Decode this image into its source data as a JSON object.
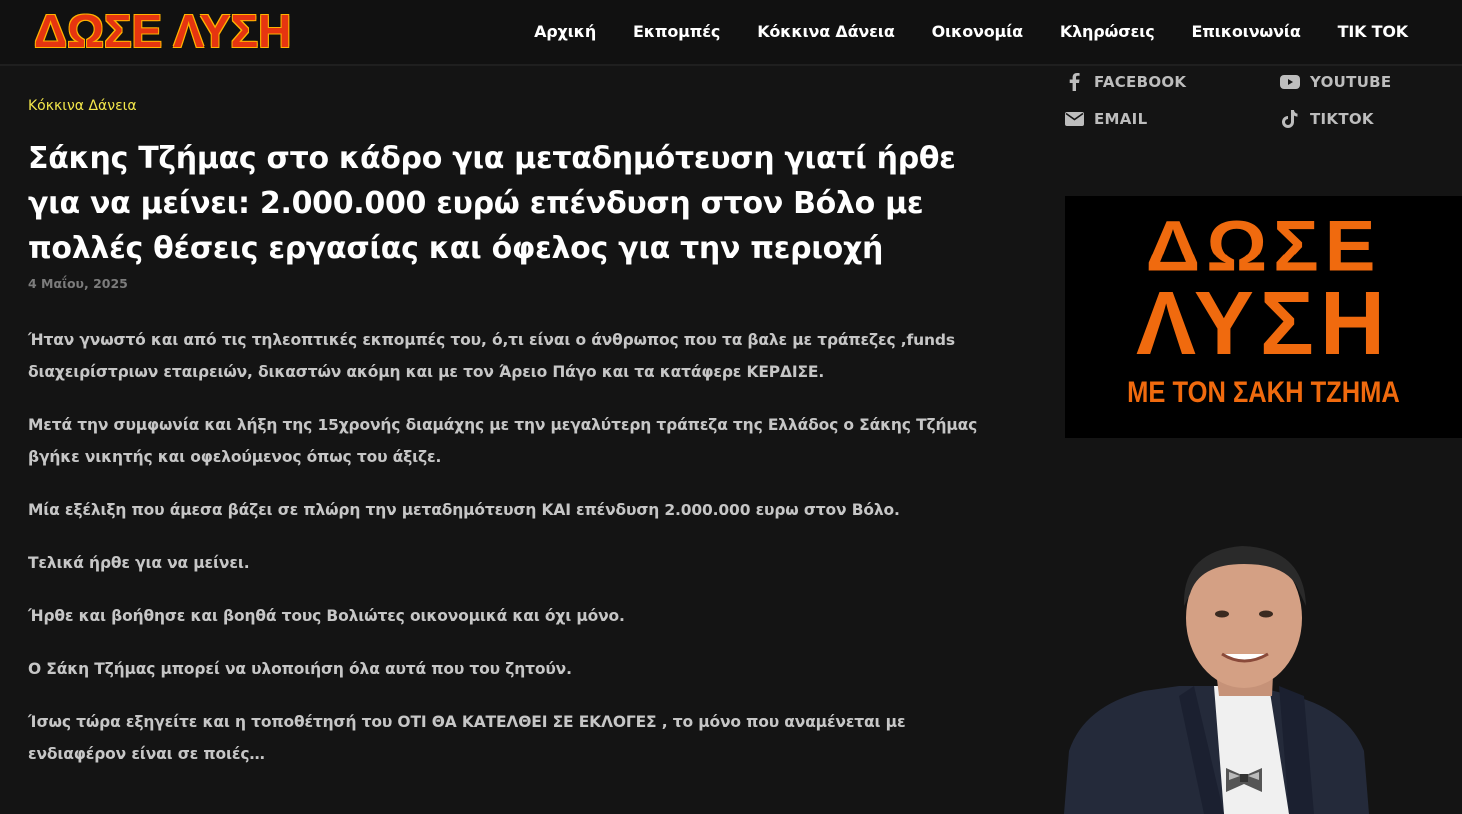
{
  "header": {
    "logo_text": "ΔΩΣΕ ΛΥΣΗ",
    "nav": [
      "Αρχική",
      "Εκπομπές",
      "Κόκκινα Δάνεια",
      "Οικονομία",
      "Κληρώσεις",
      "Επικοινωνία",
      "TIK TOK"
    ]
  },
  "article": {
    "category": "Κόκκινα Δάνεια",
    "title": "Σάκης Τζήμας στο κάδρο για μεταδημότευση γιατί ήρθε για να μείνει: 2.000.000 ευρώ επένδυση στον Βόλο με πολλές θέσεις εργασίας και όφελος για την περιοχή",
    "date": "4 Μαΐου, 2025",
    "paragraphs": [
      "Ήταν γνωστό και από τις τηλεοπτικές εκπομπές του, ό,τι είναι ο άνθρωπος που τα βαλε με τράπεζες ,funds διαχειρίστριων εταιρειών, δικαστών ακόμη και με τον Άρειο Πάγο και τα κατάφερε ΚΕΡΔΙΣΕ.",
      "Μετά την συμφωνία και λήξη της 15χρονής διαμάχης με την μεγαλύτερη τράπεζα της Ελλάδος ο Σάκης Τζήμας βγήκε νικητής και οφελούμενος όπως του άξιζε.",
      "Μία εξέλιξη που άμεσα βάζει σε πλώρη την μεταδημότευση ΚΑΙ επένδυση 2.000.000 ευρω στον Βόλο.",
      "Τελικά ήρθε για να μείνει.",
      "Ήρθε και βοήθησε και βοηθά τους Βολιώτες οικονομικά και όχι μόνο.",
      "Ο Σάκη Τζήμας μπορεί να υλοποιήση όλα αυτά που του ζητούν.",
      "Ίσως τώρα εξηγείτε και η τοποθέτησή του ΟΤΙ ΘΑ ΚΑΤΕΛΘΕΙ ΣΕ ΕΚΛΟΓΕΣ , το μόνο που αναμένεται με ενδιαφέρον είναι σε ποιές…"
    ]
  },
  "sidebar": {
    "social": {
      "facebook": "FACEBOOK",
      "youtube": "YOUTUBE",
      "email": "EMAIL",
      "tiktok": "TIKTOK"
    },
    "banner": {
      "line1": "ΔΩΣΕ",
      "line2": "ΛΥΣΗ",
      "line3": "ΜΕ ΤΟΝ ΣΑΚΗ ΤΖΗΜΑ"
    }
  },
  "colors": {
    "background": "#141414",
    "category": "#f2e64a",
    "logo_red": "#e63510",
    "banner_orange": "#f06a0e"
  }
}
